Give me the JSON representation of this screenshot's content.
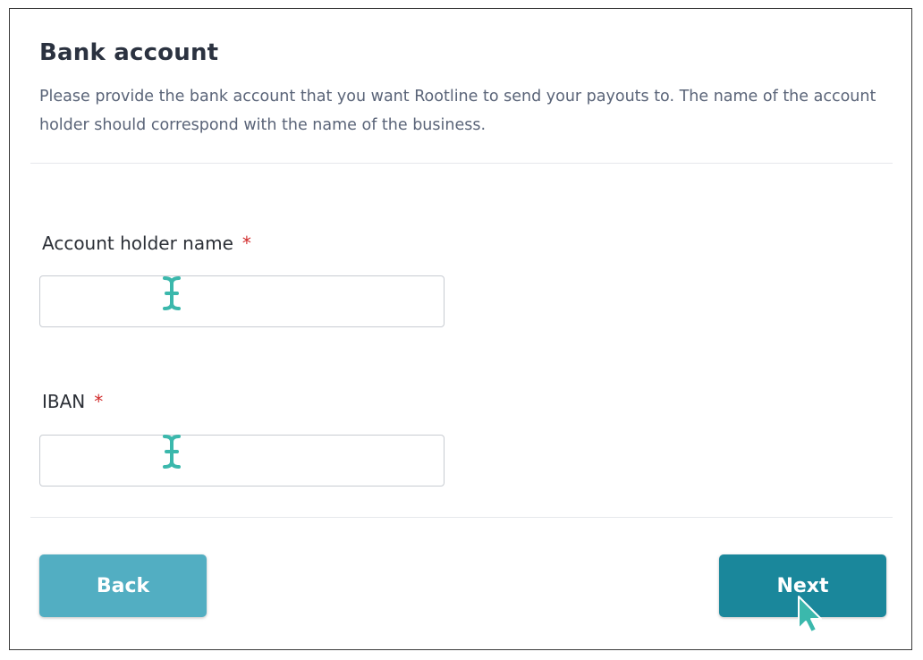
{
  "form": {
    "title": "Bank account",
    "description": "Please provide the bank account that you want Rootline to send your payouts to. The name of the account holder should correspond with the name of the business."
  },
  "fields": {
    "account_holder_name": {
      "label": "Account holder name",
      "required_marker": "*",
      "value": "",
      "placeholder": ""
    },
    "iban": {
      "label": "IBAN",
      "required_marker": "*",
      "value": "",
      "placeholder": ""
    }
  },
  "buttons": {
    "back_label": "Back",
    "next_label": "Next"
  },
  "colors": {
    "back_button": "#52aec2",
    "next_button": "#1a879b",
    "cursor_accent": "#3bb8ac",
    "required_marker": "#d12b2b"
  },
  "icons": {
    "text_cursor": "i-beam-cursor-icon",
    "pointer": "arrow-cursor-icon"
  }
}
